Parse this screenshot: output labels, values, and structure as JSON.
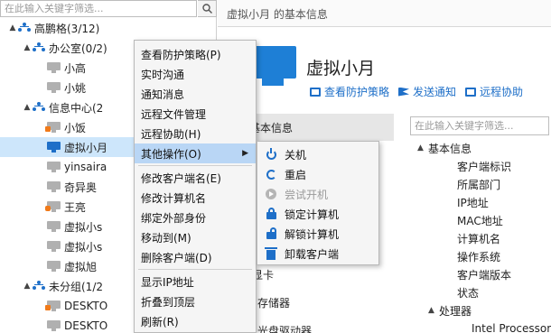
{
  "left_panel": {
    "search_placeholder": "在此输入关键字筛选...",
    "tree": [
      {
        "label": "高鹏格(3/12)",
        "indent": 0,
        "arrow": "▲",
        "icon": "org-icon"
      },
      {
        "label": "办公室(0/2)",
        "indent": 1,
        "arrow": "▲",
        "icon": "org-icon"
      },
      {
        "label": "小高",
        "indent": 2,
        "arrow": "",
        "icon": "computer-offline-icon"
      },
      {
        "label": "小姚",
        "indent": 2,
        "arrow": "",
        "icon": "computer-offline-icon"
      },
      {
        "label": "信息中心(2",
        "indent": 1,
        "arrow": "▲",
        "icon": "org-icon"
      },
      {
        "label": "小饭",
        "indent": 2,
        "arrow": "",
        "icon": "computer-warning-icon"
      },
      {
        "label": "虚拟小月",
        "indent": 2,
        "arrow": "",
        "icon": "computer-online-icon",
        "selected": true
      },
      {
        "label": "yinsaira",
        "indent": 2,
        "arrow": "",
        "icon": "computer-offline-icon"
      },
      {
        "label": "奇异奥",
        "indent": 2,
        "arrow": "",
        "icon": "computer-offline-icon"
      },
      {
        "label": "王亮",
        "indent": 2,
        "arrow": "",
        "icon": "computer-locked-icon"
      },
      {
        "label": "虚拟小s",
        "indent": 2,
        "arrow": "",
        "icon": "computer-offline-icon"
      },
      {
        "label": "虚拟小s",
        "indent": 2,
        "arrow": "",
        "icon": "computer-offline-icon"
      },
      {
        "label": "虚拟旭",
        "indent": 2,
        "arrow": "",
        "icon": "computer-offline-icon"
      },
      {
        "label": "未分组(1/2",
        "indent": 1,
        "arrow": "▲",
        "icon": "org-icon"
      },
      {
        "label": "DESKTO",
        "indent": 2,
        "arrow": "",
        "icon": "computer-warning-icon"
      },
      {
        "label": "DESKTO",
        "indent": 2,
        "arrow": "",
        "icon": "computer-offline-icon"
      }
    ]
  },
  "right_panel": {
    "header_title": "虚拟小月 的基本信息",
    "computer_name": "虚拟小月",
    "links": [
      {
        "label": "查看防护策略",
        "icon": "shield-icon"
      },
      {
        "label": "发送通知",
        "icon": "flag-icon"
      },
      {
        "label": "远程协助",
        "icon": "monitor-icon"
      }
    ],
    "basic_info_tab": "基本信息",
    "search_placeholder": "在此输入关键字筛选...",
    "fragments": [
      "显卡",
      "存储器",
      "光盘驱动器"
    ],
    "properties": [
      {
        "label": "基本信息",
        "level": 0,
        "arrow": "▲"
      },
      {
        "label": "客户端标识",
        "level": 1,
        "arrow": ""
      },
      {
        "label": "所属部门",
        "level": 1,
        "arrow": ""
      },
      {
        "label": "IP地址",
        "level": 1,
        "arrow": ""
      },
      {
        "label": "MAC地址",
        "level": 1,
        "arrow": ""
      },
      {
        "label": "计算机名",
        "level": 1,
        "arrow": ""
      },
      {
        "label": "操作系统",
        "level": 1,
        "arrow": ""
      },
      {
        "label": "客户端版本",
        "level": 1,
        "arrow": ""
      },
      {
        "label": "状态",
        "level": 1,
        "arrow": ""
      },
      {
        "label": "处理器",
        "level": 0.5,
        "arrow": "▲"
      },
      {
        "label": "Intel Processor",
        "level": 1.5,
        "arrow": ""
      }
    ]
  },
  "context_menu": {
    "items": [
      {
        "label": "查看防护策略(P)"
      },
      {
        "label": "实时沟通"
      },
      {
        "label": "通知消息"
      },
      {
        "label": "远程文件管理"
      },
      {
        "label": "远程协助(H)"
      },
      {
        "label": "其他操作(O)",
        "highlighted": true,
        "submenu": true
      },
      {
        "label": "修改客户端名(E)"
      },
      {
        "label": "修改计算机名"
      },
      {
        "label": "绑定外部身份"
      },
      {
        "label": "移动到(M)"
      },
      {
        "label": "删除客户端(D)"
      },
      {
        "label": "显示IP地址"
      },
      {
        "label": "折叠到顶层"
      },
      {
        "label": "刷新(R)"
      }
    ]
  },
  "submenu": {
    "items": [
      {
        "label": "关机",
        "icon": "power-icon",
        "enabled": true
      },
      {
        "label": "重启",
        "icon": "restart-icon",
        "enabled": true
      },
      {
        "label": "尝试开机",
        "icon": "power-on-icon",
        "enabled": false
      },
      {
        "label": "锁定计算机",
        "icon": "lock-icon",
        "enabled": true
      },
      {
        "label": "解锁计算机",
        "icon": "unlock-icon",
        "enabled": true
      },
      {
        "label": "卸载客户端",
        "icon": "trash-icon",
        "enabled": true
      }
    ]
  },
  "colors": {
    "accent": "#1e6fc8",
    "menu_highlight": "#b9d6f5",
    "warning": "#f07a1a"
  }
}
